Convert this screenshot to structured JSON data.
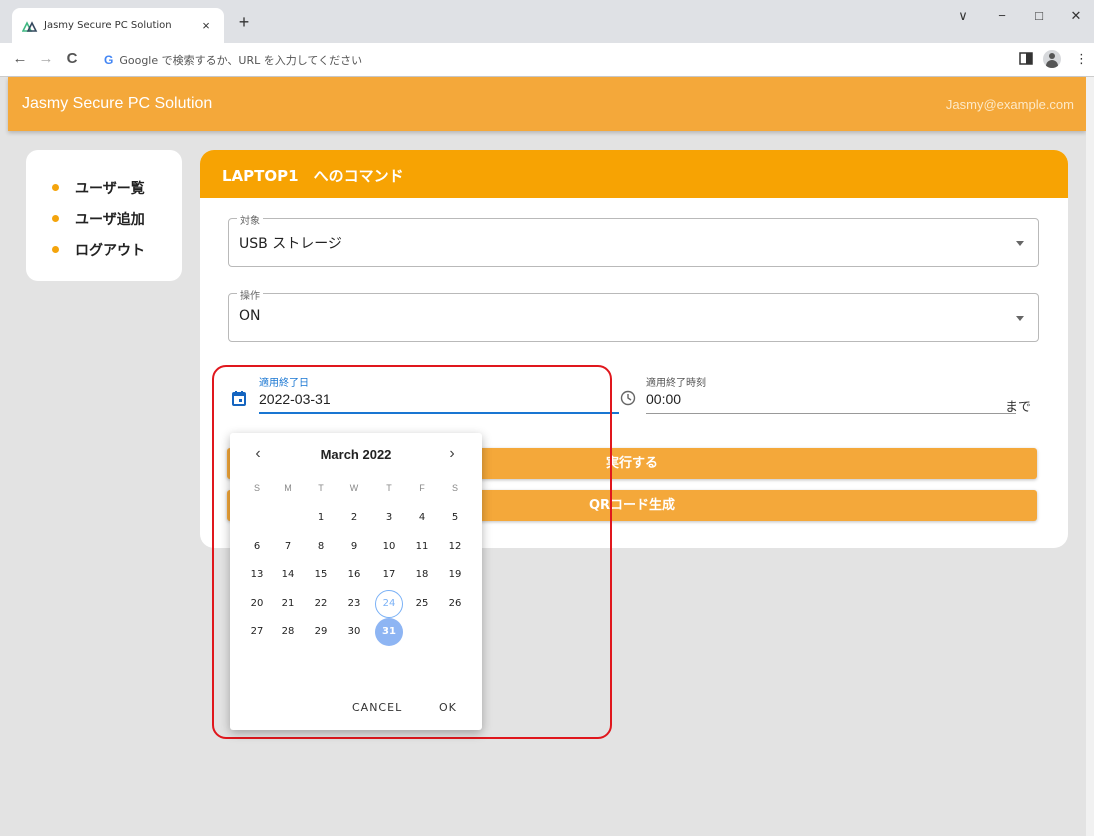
{
  "browser": {
    "tab_title": "Jasmy Secure PC Solution",
    "tab_close": "×",
    "new_tab": "+",
    "win_controls": [
      "∨",
      "−",
      "□",
      "✕"
    ],
    "nav": {
      "back": "←",
      "forward": "→",
      "reload": "C"
    },
    "omnibox_g": "G",
    "omnibox_placeholder": "Google で検索するか、URL を入力してください",
    "menu": "⋮"
  },
  "app": {
    "brand": "Jasmy Secure PC Solution",
    "user": "Jasmy@example.com",
    "accent": "#f4a83a"
  },
  "sidebar": {
    "items": [
      {
        "label": "ユーザー覧"
      },
      {
        "label": "ユーザ追加"
      },
      {
        "label": "ログアウト"
      }
    ]
  },
  "panel": {
    "title": "LAPTOP1　へのコマンド",
    "target": {
      "legend": "対象",
      "value": "USB ストレージ"
    },
    "operation": {
      "legend": "操作",
      "value": "ON"
    },
    "end_date": {
      "label": "適用終了日",
      "value": "2022-03-31"
    },
    "end_time": {
      "label": "適用終了時刻",
      "value": "00:00"
    },
    "until": "まで",
    "execute_button": "実行する",
    "qr_button": "QRコード生成"
  },
  "datepicker": {
    "month_label": "March 2022",
    "prev": "‹",
    "next": "›",
    "weekdays": [
      "S",
      "M",
      "T",
      "W",
      "T",
      "F",
      "S"
    ],
    "weeks": [
      [
        "",
        "",
        "1",
        "2",
        "3",
        "4",
        "5"
      ],
      [
        "6",
        "7",
        "8",
        "9",
        "10",
        "11",
        "12"
      ],
      [
        "13",
        "14",
        "15",
        "16",
        "17",
        "18",
        "19"
      ],
      [
        "20",
        "21",
        "22",
        "23",
        "24",
        "25",
        "26"
      ],
      [
        "27",
        "28",
        "29",
        "30",
        "31",
        "",
        ""
      ]
    ],
    "today": "24",
    "selected": "31",
    "cancel": "CANCEL",
    "ok": "OK"
  }
}
